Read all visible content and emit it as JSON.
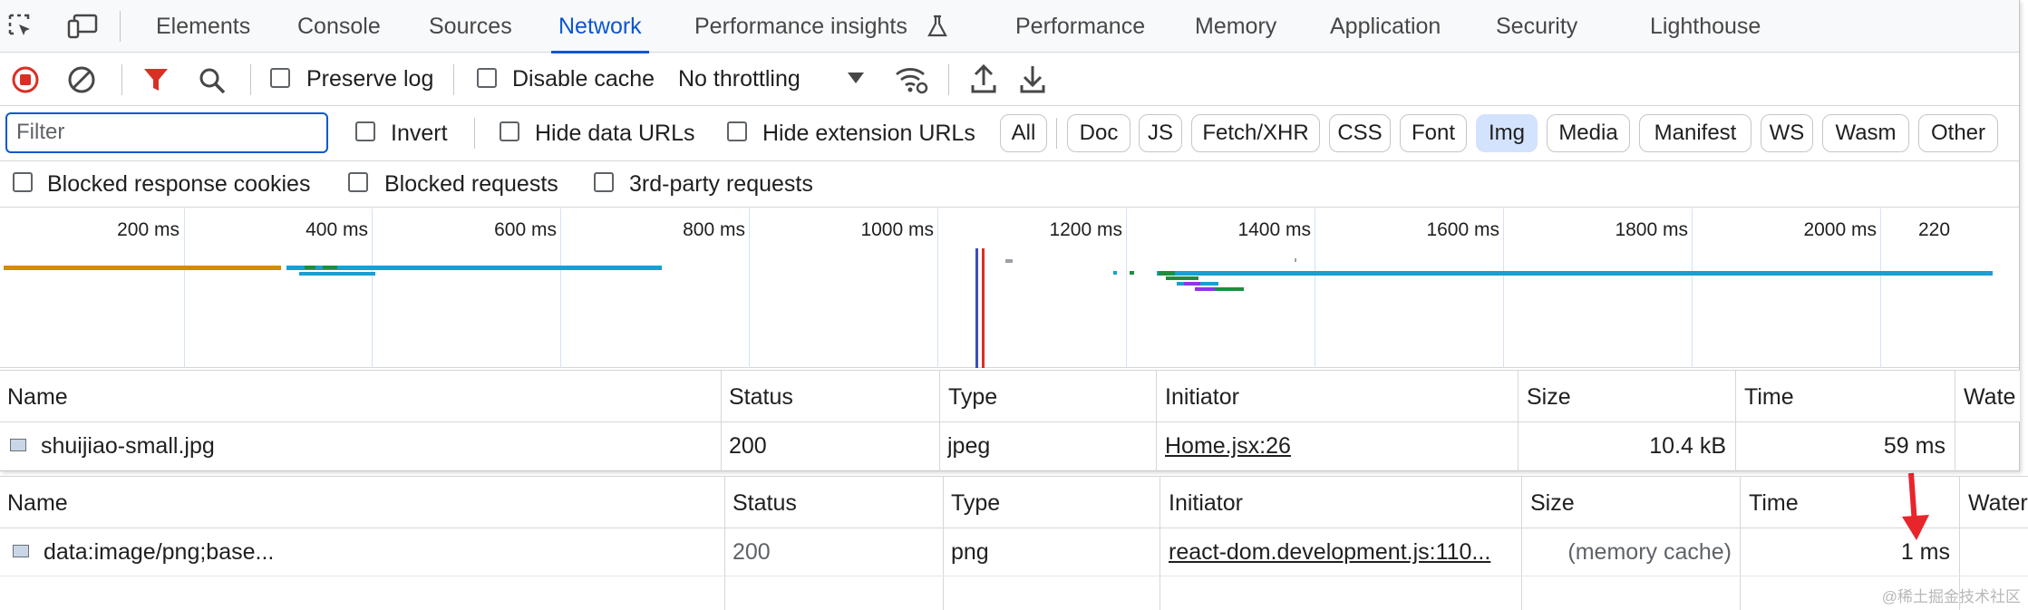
{
  "tabs": [
    {
      "label": "Elements"
    },
    {
      "label": "Console"
    },
    {
      "label": "Sources"
    },
    {
      "label": "Network"
    },
    {
      "label": "Performance insights"
    },
    {
      "label": "Performance"
    },
    {
      "label": "Memory"
    },
    {
      "label": "Application"
    },
    {
      "label": "Security"
    },
    {
      "label": "Lighthouse"
    }
  ],
  "toolbar": {
    "preserve_log": "Preserve log",
    "disable_cache": "Disable cache",
    "throttling": "No throttling"
  },
  "filter": {
    "placeholder": "Filter",
    "invert": "Invert",
    "hide_data_urls": "Hide data URLs",
    "hide_extension_urls": "Hide extension URLs",
    "chips": [
      "All",
      "Doc",
      "JS",
      "Fetch/XHR",
      "CSS",
      "Font",
      "Img",
      "Media",
      "Manifest",
      "WS",
      "Wasm",
      "Other"
    ],
    "selected": "Img"
  },
  "row3": {
    "blocked_cookies": "Blocked response cookies",
    "blocked_requests": "Blocked requests",
    "third_party": "3rd-party requests"
  },
  "overview": {
    "ticks": [
      "200 ms",
      "400 ms",
      "600 ms",
      "800 ms",
      "1000 ms",
      "1200 ms",
      "1400 ms",
      "1600 ms",
      "1800 ms",
      "2000 ms",
      "220"
    ]
  },
  "columns": [
    "Name",
    "Status",
    "Type",
    "Initiator",
    "Size",
    "Time",
    "Wate"
  ],
  "row1": {
    "name": "shuijiao-small.jpg",
    "status": "200",
    "type": "jpeg",
    "initiator": "Home.jsx:26",
    "size": "10.4 kB",
    "time": "59 ms"
  },
  "back": {
    "columns": [
      "Name",
      "Status",
      "Type",
      "Initiator",
      "Size",
      "Time",
      "Water"
    ],
    "row": {
      "name": "data:image/png;base...",
      "status": "200",
      "type": "png",
      "initiator": "react-dom.development.js:110...",
      "size": "(memory cache)",
      "time": "1 ms"
    },
    "watermark": "@稀土掘金技术社区"
  },
  "colors": {
    "accent": "#0b57d0",
    "record": "#d93025",
    "annotation_arrow": "#e8252b"
  }
}
